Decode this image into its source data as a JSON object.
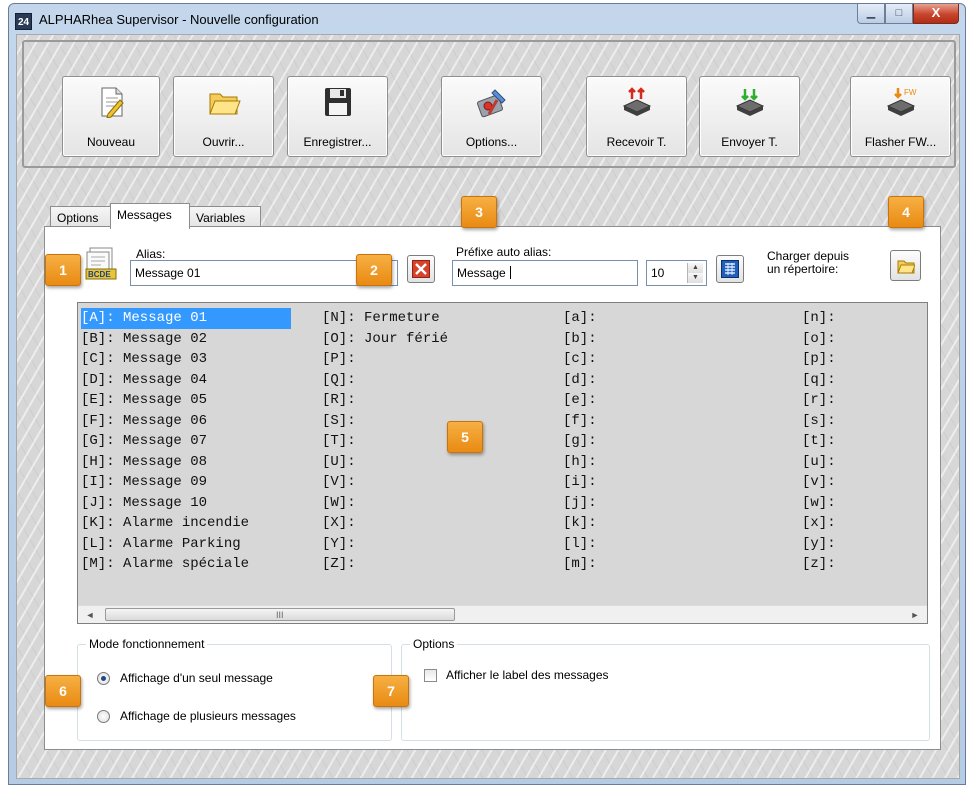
{
  "window": {
    "app_icon": "24",
    "title": "ALPHARhea Supervisor - Nouvelle configuration",
    "minimize_icon": "minimize-icon",
    "maximize_icon": "maximize-icon",
    "close_icon": "close-icon",
    "close_glyph": "X"
  },
  "toolbar": {
    "buttons": [
      {
        "label": "Nouveau",
        "icon": "new-document-icon"
      },
      {
        "label": "Ouvrir...",
        "icon": "folder-open-icon"
      },
      {
        "label": "Enregistrer...",
        "icon": "floppy-disk-icon"
      },
      {
        "label": "Options...",
        "icon": "tools-icon"
      },
      {
        "label": "Recevoir T.",
        "icon": "receive-device-icon"
      },
      {
        "label": "Envoyer T.",
        "icon": "send-device-icon"
      },
      {
        "label": "Flasher FW...",
        "icon": "flash-firmware-icon",
        "icon_text": "FW"
      }
    ]
  },
  "tabs": [
    "Options",
    "Messages",
    "Variables"
  ],
  "active_tab": "Messages",
  "alias": {
    "icon": "message-card-icon",
    "icon_text": "BCDE",
    "label": "Alias:",
    "value": "Message 01",
    "clear_icon": "clear-x-icon"
  },
  "auto_alias": {
    "label": "Préfixe auto alias:",
    "prefix_value": "Message ",
    "number_value": "10",
    "apply_icon": "numbered-list-icon"
  },
  "load_dir": {
    "label_line1": "Charger depuis",
    "label_line2": "un répertoire:",
    "icon": "folder-icon"
  },
  "messages": {
    "columns": [
      [
        "[A]: Message 01",
        "[B]: Message 02",
        "[C]: Message 03",
        "[D]: Message 04",
        "[E]: Message 05",
        "[F]: Message 06",
        "[G]: Message 07",
        "[H]: Message 08",
        "[I]: Message 09",
        "[J]: Message 10",
        "[K]: Alarme incendie",
        "[L]: Alarme Parking",
        "[M]: Alarme spéciale"
      ],
      [
        "[N]: Fermeture",
        "[O]: Jour férié",
        "[P]:",
        "[Q]:",
        "[R]:",
        "[S]:",
        "[T]:",
        "[U]:",
        "[V]:",
        "[W]:",
        "[X]:",
        "[Y]:",
        "[Z]:"
      ],
      [
        "[a]:",
        "[b]:",
        "[c]:",
        "[d]:",
        "[e]:",
        "[f]:",
        "[g]:",
        "[h]:",
        "[i]:",
        "[j]:",
        "[k]:",
        "[l]:",
        "[m]:"
      ],
      [
        "[n]:",
        "[o]:",
        "[p]:",
        "[q]:",
        "[r]:",
        "[s]:",
        "[t]:",
        "[u]:",
        "[v]:",
        "[w]:",
        "[x]:",
        "[y]:",
        "[z]:"
      ]
    ],
    "selected": "[A]: Message 01",
    "scroll_left_glyph": "◄",
    "scroll_right_glyph": "►",
    "scroll_grip": "III"
  },
  "mode_group": {
    "title": "Mode fonctionnement",
    "options": [
      "Affichage d'un seul message",
      "Affichage de plusieurs messages"
    ],
    "selected_index": 0
  },
  "options_group": {
    "title": "Options",
    "checkbox_label": "Afficher le label des messages",
    "checked": false
  },
  "markers": [
    "1",
    "2",
    "3",
    "4",
    "5",
    "6",
    "7"
  ],
  "colors": {
    "marker_orange": "#EE961C",
    "selection_blue": "#3399FF",
    "clear_red": "#D9412B"
  }
}
